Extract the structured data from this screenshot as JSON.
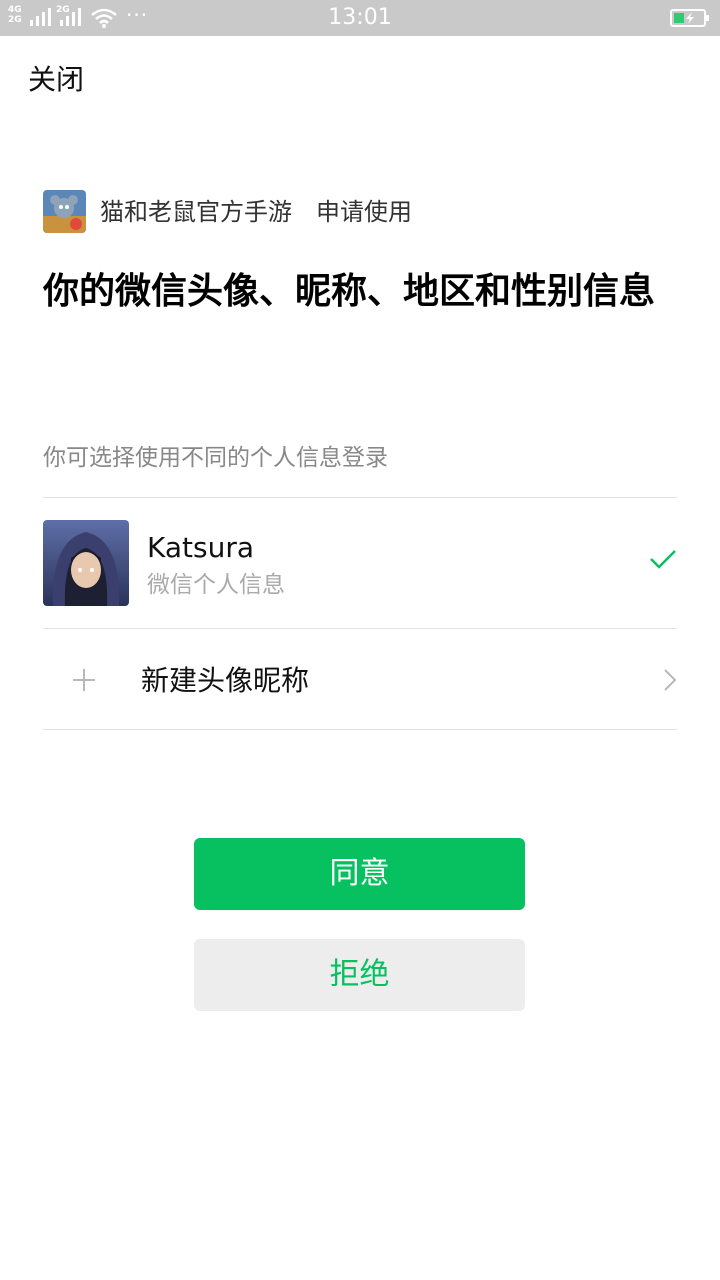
{
  "status_bar": {
    "net_a_top": "4G",
    "net_a_bottom": "2G",
    "net_b": "2G",
    "dots": "···",
    "time": "13:01",
    "battery_color": "#2ecc71"
  },
  "header": {
    "close_label": "关闭"
  },
  "app": {
    "name": "猫和老鼠官方手游",
    "action": "申请使用"
  },
  "title": "你的微信头像、昵称、地区和性别信息",
  "hint": "你可选择使用不同的个人信息登录",
  "accounts": [
    {
      "name": "Katsura",
      "subtitle": "微信个人信息",
      "selected": true
    }
  ],
  "new_profile_label": "新建头像昵称",
  "buttons": {
    "agree": "同意",
    "reject": "拒绝"
  },
  "colors": {
    "accent": "#07c160",
    "status_bar": "#c9c9c9",
    "reject_bg": "#ededed"
  }
}
